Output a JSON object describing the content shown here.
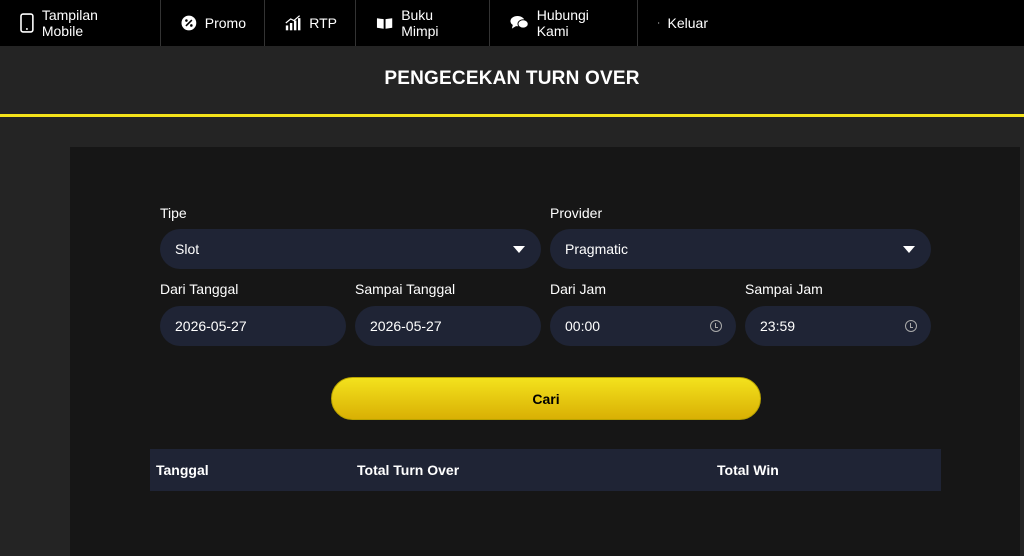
{
  "nav": {
    "items": [
      {
        "label": "Tampilan Mobile",
        "icon": "mobile-phone-icon"
      },
      {
        "label": "Promo",
        "icon": "percent-icon"
      },
      {
        "label": "RTP",
        "icon": "bar-chart-icon"
      },
      {
        "label": "Buku Mimpi",
        "icon": "open-book-icon"
      },
      {
        "label": "Hubungi Kami",
        "icon": "chat-bubbles-icon"
      },
      {
        "label": "Keluar",
        "icon": "logout-icon"
      }
    ]
  },
  "page": {
    "title": "PENGECEKAN TURN OVER"
  },
  "form": {
    "tipe": {
      "label": "Tipe",
      "value": "Slot"
    },
    "provider": {
      "label": "Provider",
      "value": "Pragmatic"
    },
    "dari_tanggal": {
      "label": "Dari Tanggal",
      "value": "2026-05-27"
    },
    "sampai_tanggal": {
      "label": "Sampai Tanggal",
      "value": "2026-05-27"
    },
    "dari_jam": {
      "label": "Dari Jam",
      "value": "00:00"
    },
    "sampai_jam": {
      "label": "Sampai Jam",
      "value": "23:59"
    },
    "submit_label": "Cari"
  },
  "table": {
    "columns": [
      "Tanggal",
      "Total Turn Over",
      "Total Win"
    ]
  },
  "colors": {
    "accent": "#f4e21a",
    "field_bg": "#1f2435",
    "nav_bg": "#000000"
  }
}
